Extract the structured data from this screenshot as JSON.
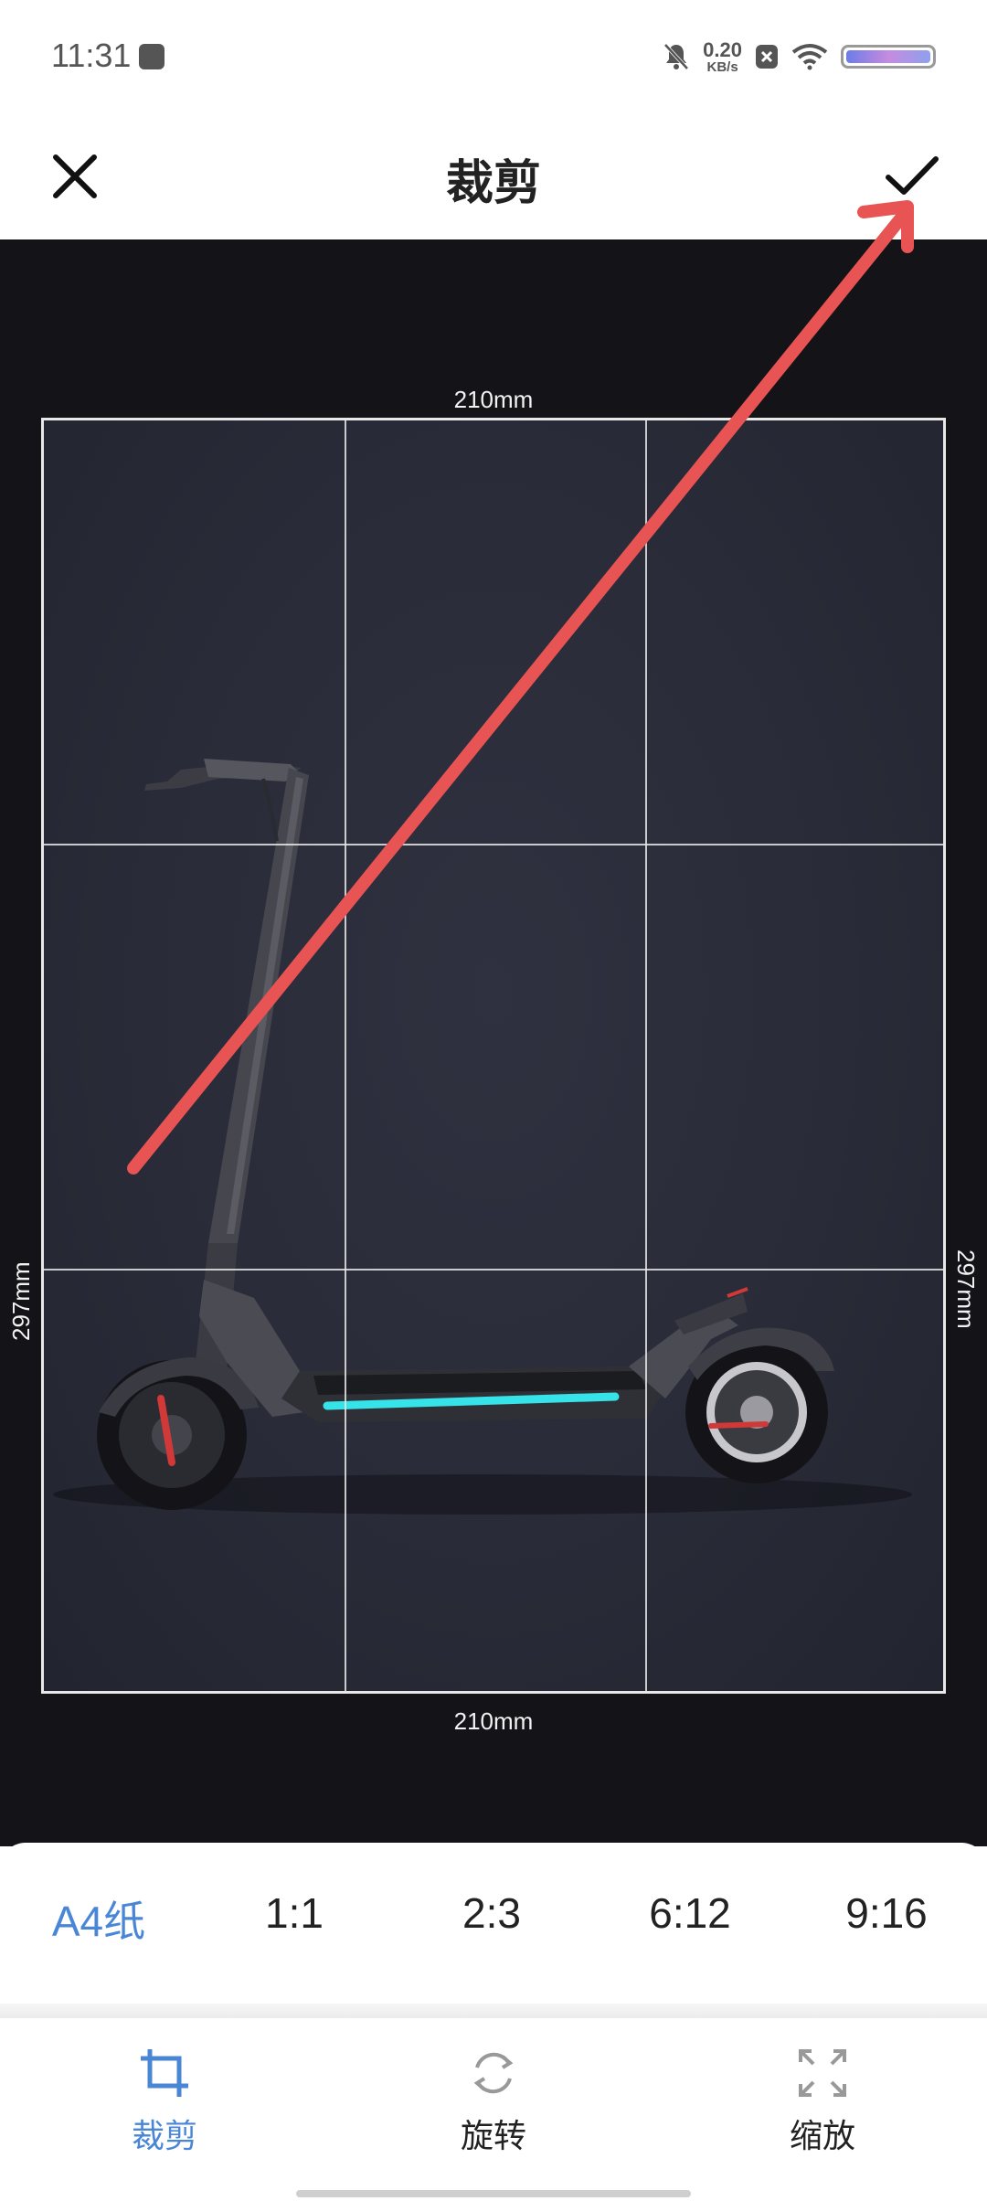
{
  "status_bar": {
    "time": "11:31",
    "net_speed_value": "0.20",
    "net_speed_unit": "KB/s",
    "icons": [
      "notification-app-icon",
      "mute-bell-icon",
      "sim-x-icon",
      "wifi-icon",
      "battery-icon"
    ]
  },
  "header": {
    "title": "裁剪",
    "close_icon": "close-icon",
    "confirm_icon": "check-icon"
  },
  "crop": {
    "width_label_top": "210mm",
    "width_label_bottom": "210mm",
    "height_label_left": "297mm",
    "height_label_right": "297mm",
    "image": "electric-scooter-image",
    "annotation_arrow_color": "#e85454"
  },
  "ratios": {
    "items": [
      {
        "label": "A4纸",
        "active": true
      },
      {
        "label": "1:1",
        "active": false
      },
      {
        "label": "2:3",
        "active": false
      },
      {
        "label": "6:12",
        "active": false
      },
      {
        "label": "9:16",
        "active": false
      }
    ]
  },
  "tools": {
    "items": [
      {
        "label": "裁剪",
        "icon": "crop-icon",
        "active": true
      },
      {
        "label": "旋转",
        "icon": "rotate-icon",
        "active": false
      },
      {
        "label": "缩放",
        "icon": "expand-icon",
        "active": false
      }
    ]
  },
  "colors": {
    "accent": "#4a86d6",
    "canvas_bg": "#131318",
    "arrow": "#e85454"
  }
}
